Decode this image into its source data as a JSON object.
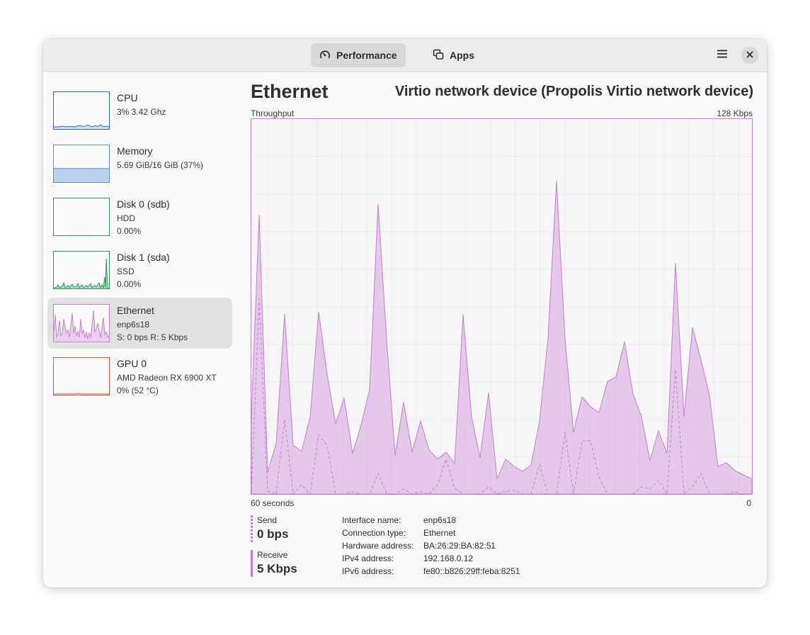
{
  "header": {
    "tabs": [
      {
        "label": "Performance",
        "icon": "speedometer-icon",
        "active": true
      },
      {
        "label": "Apps",
        "icon": "apps-windows-icon",
        "active": false
      }
    ],
    "menu_icon": "hamburger-menu-icon",
    "close_icon": "close-icon"
  },
  "sidebar": {
    "items": [
      {
        "title": "CPU",
        "lines": [
          "3% 3.42 Ghz"
        ],
        "color": "#2a6bc7"
      },
      {
        "title": "Memory",
        "lines": [
          "5.69 GiB/16 GiB (37%)"
        ],
        "color": "#5b8fd6",
        "fill_fraction": 0.37
      },
      {
        "title": "Disk 0 (sdb)",
        "lines": [
          "HDD",
          "0.00%"
        ],
        "color": "#2a9a5b"
      },
      {
        "title": "Disk 1 (sda)",
        "lines": [
          "SSD",
          "0.00%"
        ],
        "color": "#2a9a5b"
      },
      {
        "title": "Ethernet",
        "lines": [
          "enp6s18",
          "S: 0 bps R: 5 Kbps"
        ],
        "color": "#c77ed4",
        "selected": true
      },
      {
        "title": "GPU 0",
        "lines": [
          "AMD Radeon RX 6900 XT",
          "0% (52 °C)"
        ],
        "color": "#e0523a"
      }
    ]
  },
  "main": {
    "title": "Ethernet",
    "device": "Virtio network device (Propolis Virtio network device)",
    "graph": {
      "top_left": "Throughput",
      "top_right": "128 Kbps",
      "bottom_left": "60 seconds",
      "bottom_right": "0",
      "color": "#c77ed4"
    },
    "legend": {
      "send": {
        "label": "Send",
        "value": "0 bps"
      },
      "receive": {
        "label": "Receive",
        "value": "5 Kbps"
      }
    },
    "details": [
      {
        "key": "Interface name:",
        "value": "enp6s18"
      },
      {
        "key": "Connection type:",
        "value": "Ethernet"
      },
      {
        "key": "Hardware address:",
        "value": "BA:26:29:BA:82:51"
      },
      {
        "key": "IPv4 address:",
        "value": "192.168.0.12"
      },
      {
        "key": "IPv6 address:",
        "value": "fe80::b826:29ff:feba:8251"
      }
    ]
  }
}
